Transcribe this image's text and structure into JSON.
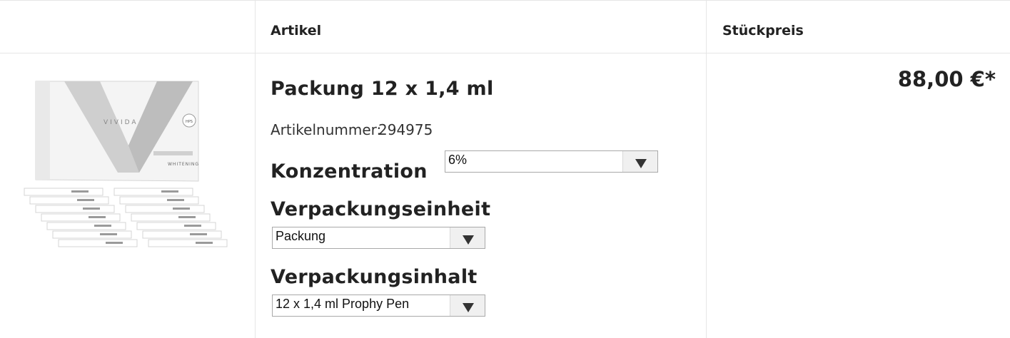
{
  "header": {
    "col_article": "Artikel",
    "col_unit_price": "Stückpreis"
  },
  "product": {
    "title": "Packung 12 x 1,4 ml",
    "article_number_label": "Artikelnummer:",
    "article_number": "294975",
    "image_icon": "product-box-image",
    "image_brand": "VIVIDA",
    "image_sub": "WHITENING",
    "options": [
      {
        "label": "Konzentration",
        "selected": "6%"
      },
      {
        "label": "Verpackungseinheit",
        "selected": "Packung"
      },
      {
        "label": "Verpackungsinhalt",
        "selected": "12 x 1,4 ml Prophy Pen"
      }
    ],
    "price": "88,00 €*"
  }
}
